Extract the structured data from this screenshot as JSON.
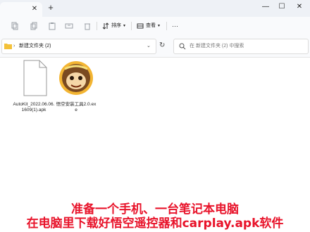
{
  "window": {
    "tab_close_glyph": "✕",
    "tab_new_glyph": "+",
    "minimize_glyph": "—",
    "maximize_glyph": "☐",
    "close_glyph": "✕"
  },
  "toolbar": {
    "sort_label": "排序",
    "view_label": "查看",
    "more_glyph": "···"
  },
  "address": {
    "path": "新建文件夹 (2)",
    "search_placeholder": "在 新建文件夹 (2) 中搜索"
  },
  "files": [
    {
      "name": "AutoKit_2022.06.06.1609(1).apk",
      "icon": "document-icon"
    },
    {
      "name": "悟空安装工具2.0.exe",
      "icon": "monkey-app-icon"
    }
  ],
  "overlay": {
    "line1": "准备一个手机、一台笔记本电脑",
    "line2": "在电脑里下载好悟空遥控器和carplay.apk软件"
  },
  "colors": {
    "overlay_text": "#e8132a",
    "folder": "#f3c13a"
  }
}
